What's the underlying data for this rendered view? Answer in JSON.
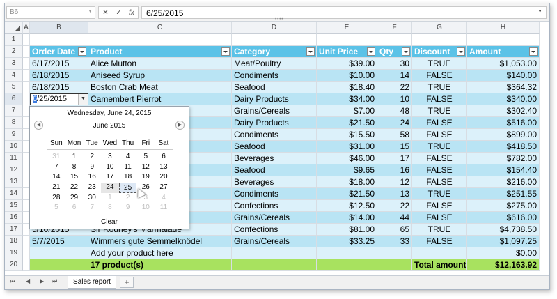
{
  "formula_bar": {
    "name_box": "B6",
    "fx_cancel": "✕",
    "fx_enter": "✓",
    "fx_label": "fx",
    "formula_value": "6/25/2015"
  },
  "columns": [
    "A",
    "B",
    "C",
    "D",
    "E",
    "F",
    "G",
    "H"
  ],
  "rows": [
    "1",
    "2",
    "3",
    "4",
    "5",
    "6",
    "7",
    "8",
    "9",
    "10",
    "11",
    "12",
    "13",
    "14",
    "15",
    "16",
    "17",
    "18",
    "19",
    "20"
  ],
  "table": {
    "headers": [
      "Order Date",
      "Product",
      "Category",
      "Unit Price",
      "Qty",
      "Discount",
      "Amount"
    ],
    "rows": [
      [
        "6/17/2015",
        "Alice Mutton",
        "Meat/Poultry",
        "$39.00",
        "30",
        "TRUE",
        "$1,053.00"
      ],
      [
        "6/18/2015",
        "Aniseed Syrup",
        "Condiments",
        "$10.00",
        "14",
        "FALSE",
        "$140.00"
      ],
      [
        "6/18/2015",
        "Boston Crab Meat",
        "Seafood",
        "$18.40",
        "22",
        "TRUE",
        "$364.32"
      ],
      [
        "",
        "Camembert Pierrot",
        "Dairy Products",
        "$34.00",
        "10",
        "FALSE",
        "$340.00"
      ],
      [
        "",
        "",
        "Grains/Cereals",
        "$7.00",
        "48",
        "TRUE",
        "$302.40"
      ],
      [
        "",
        "",
        "Dairy Products",
        "$21.50",
        "24",
        "FALSE",
        "$516.00"
      ],
      [
        "",
        "",
        "Condiments",
        "$15.50",
        "58",
        "FALSE",
        "$899.00"
      ],
      [
        "",
        "",
        "Seafood",
        "$31.00",
        "15",
        "TRUE",
        "$418.50"
      ],
      [
        "",
        "",
        "Beverages",
        "$46.00",
        "17",
        "FALSE",
        "$782.00"
      ],
      [
        "",
        "Chowder",
        "Seafood",
        "$9.65",
        "16",
        "FALSE",
        "$154.40"
      ],
      [
        "",
        "",
        "Beverages",
        "$18.00",
        "12",
        "FALSE",
        "$216.00"
      ],
      [
        "",
        "r Sauce",
        "Condiments",
        "$21.50",
        "13",
        "TRUE",
        "$251.55"
      ],
      [
        "",
        "",
        "Confections",
        "$12.50",
        "22",
        "FALSE",
        "$275.00"
      ],
      [
        "",
        "d Mee",
        "Grains/Cereals",
        "$14.00",
        "44",
        "FALSE",
        "$616.00"
      ],
      [
        "5/10/2015",
        "Sir Rodney's Marmalade",
        "Confections",
        "$81.00",
        "65",
        "TRUE",
        "$4,738.50"
      ],
      [
        "5/7/2015",
        "Wimmers gute Semmelknödel",
        "Grains/Cereals",
        "$33.25",
        "33",
        "FALSE",
        "$1,097.25"
      ],
      [
        "",
        "Add your product here",
        "",
        "",
        "",
        "",
        "$0.00"
      ]
    ],
    "total": {
      "product_count": "17 product(s)",
      "label": "Total amount",
      "amount": "$12,163.92"
    }
  },
  "edit_cell": {
    "caret_char": "6",
    "rest": "/25/2015"
  },
  "calendar": {
    "today_label": "Wednesday, June 24, 2015",
    "month_label": "June 2015",
    "prev_icon": "◀",
    "next_icon": "▶",
    "weekdays": [
      "Sun",
      "Mon",
      "Tue",
      "Wed",
      "Thu",
      "Fri",
      "Sat"
    ],
    "days": [
      {
        "d": "31",
        "other": true
      },
      {
        "d": "1"
      },
      {
        "d": "2"
      },
      {
        "d": "3"
      },
      {
        "d": "4"
      },
      {
        "d": "5"
      },
      {
        "d": "6"
      },
      {
        "d": "7"
      },
      {
        "d": "8"
      },
      {
        "d": "9"
      },
      {
        "d": "10"
      },
      {
        "d": "11"
      },
      {
        "d": "12"
      },
      {
        "d": "13"
      },
      {
        "d": "14"
      },
      {
        "d": "15"
      },
      {
        "d": "16"
      },
      {
        "d": "17"
      },
      {
        "d": "18"
      },
      {
        "d": "19"
      },
      {
        "d": "20"
      },
      {
        "d": "21"
      },
      {
        "d": "22"
      },
      {
        "d": "23"
      },
      {
        "d": "24",
        "today": true
      },
      {
        "d": "25",
        "selected": true
      },
      {
        "d": "26"
      },
      {
        "d": "27"
      },
      {
        "d": "28"
      },
      {
        "d": "29"
      },
      {
        "d": "30"
      },
      {
        "d": "1",
        "other": true
      },
      {
        "d": "2",
        "other": true
      },
      {
        "d": "3",
        "other": true
      },
      {
        "d": "4",
        "other": true
      },
      {
        "d": "5",
        "other": true
      },
      {
        "d": "6",
        "other": true
      },
      {
        "d": "7",
        "other": true
      },
      {
        "d": "8",
        "other": true
      },
      {
        "d": "9",
        "other": true
      },
      {
        "d": "10",
        "other": true
      },
      {
        "d": "11",
        "other": true
      }
    ],
    "clear_label": "Clear"
  },
  "sheet_tabs": {
    "nav": [
      "⏮",
      "◀",
      "▶",
      "⏭"
    ],
    "active": "Sales report",
    "add": "+"
  },
  "colors": {
    "header": "#5bc2e7",
    "band_light": "#dcf1fa",
    "band_dark": "#b9e4f4",
    "total": "#a8e25f"
  }
}
